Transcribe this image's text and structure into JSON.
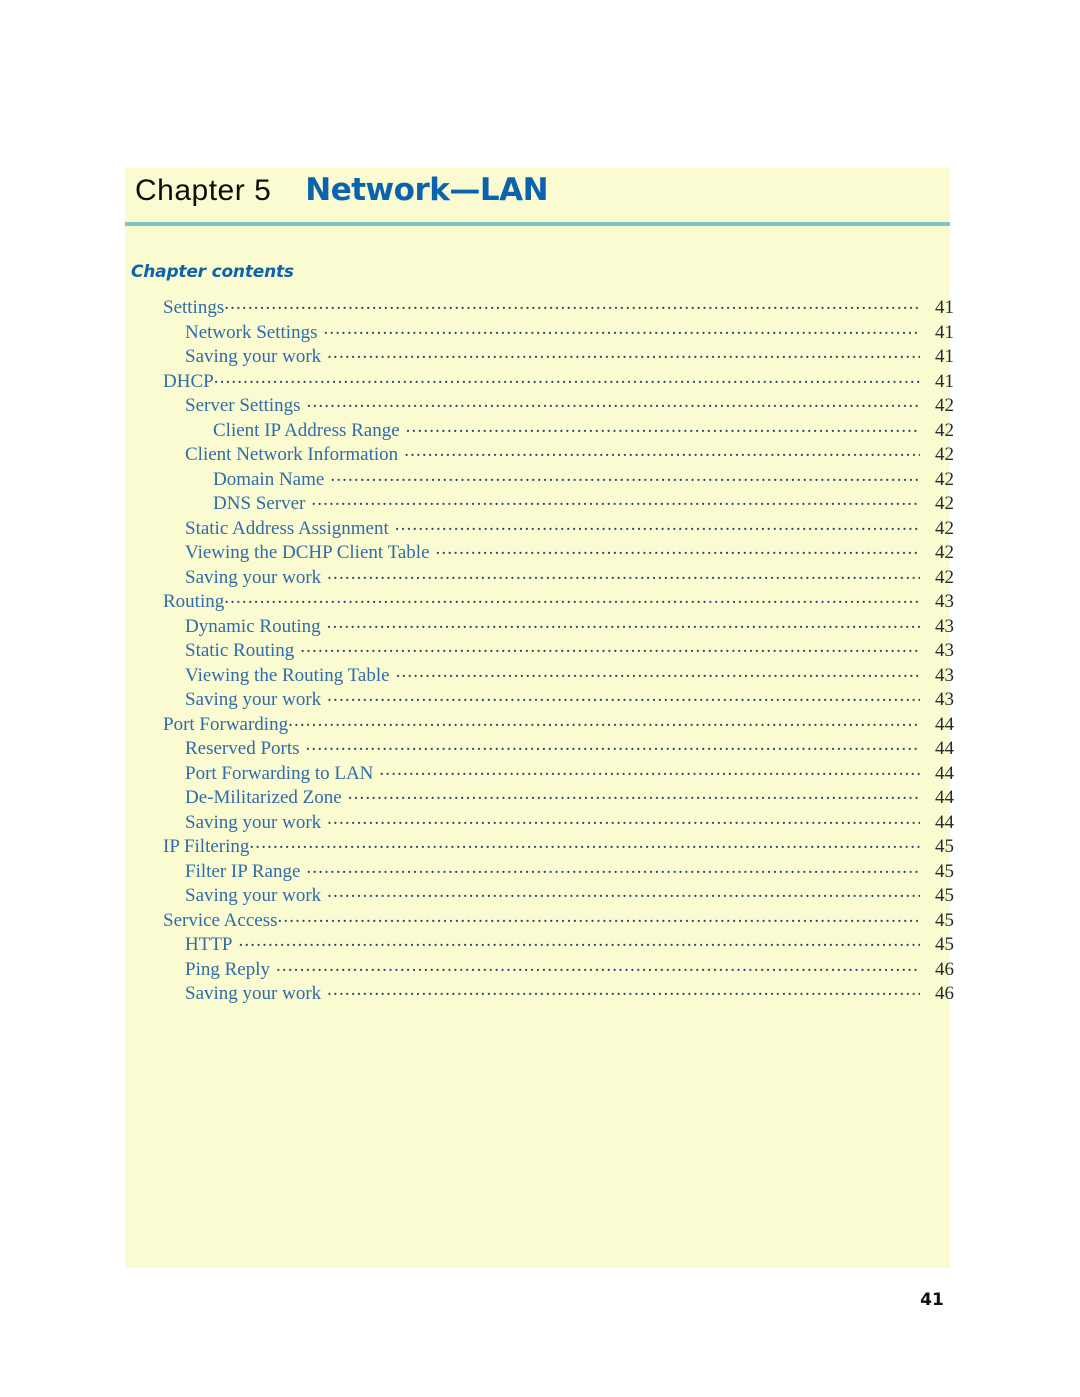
{
  "colors": {
    "page_tint": "#fbfbd2",
    "title_blue": "#0b63ad",
    "toc_blue": "#2f6ca8",
    "rule_teal": "#7ec6bf",
    "leader_dots": "#24486e",
    "folio_black": "#111111"
  },
  "header": {
    "chapter_word": "Chapter 5",
    "chapter_title": "Network—LAN"
  },
  "contents": {
    "heading": "Chapter contents",
    "entries": [
      {
        "level": 1,
        "label": "Settings",
        "page": "41"
      },
      {
        "level": 2,
        "label": "Network Settings",
        "page": "41"
      },
      {
        "level": 2,
        "label": "Saving your work",
        "page": "41"
      },
      {
        "level": 1,
        "label": "DHCP",
        "page": "41"
      },
      {
        "level": 2,
        "label": "Server Settings",
        "page": "42"
      },
      {
        "level": 3,
        "label": "Client IP Address Range",
        "page": "42"
      },
      {
        "level": 2,
        "label": "Client Network Information",
        "page": "42"
      },
      {
        "level": 3,
        "label": "Domain Name",
        "page": "42"
      },
      {
        "level": 3,
        "label": "DNS Server",
        "page": "42"
      },
      {
        "level": 2,
        "label": "Static Address Assignment",
        "page": "42"
      },
      {
        "level": 2,
        "label": "Viewing the DCHP Client Table",
        "page": "42"
      },
      {
        "level": 2,
        "label": "Saving your work",
        "page": "42"
      },
      {
        "level": 1,
        "label": "Routing",
        "page": "43"
      },
      {
        "level": 2,
        "label": "Dynamic Routing",
        "page": "43"
      },
      {
        "level": 2,
        "label": "Static Routing",
        "page": "43"
      },
      {
        "level": 2,
        "label": "Viewing the Routing Table",
        "page": "43"
      },
      {
        "level": 2,
        "label": "Saving your work",
        "page": "43"
      },
      {
        "level": 1,
        "label": "Port Forwarding",
        "page": "44"
      },
      {
        "level": 2,
        "label": "Reserved Ports",
        "page": "44"
      },
      {
        "level": 2,
        "label": "Port Forwarding to LAN",
        "page": "44"
      },
      {
        "level": 2,
        "label": "De-Militarized Zone",
        "page": "44"
      },
      {
        "level": 2,
        "label": "Saving your work",
        "page": "44"
      },
      {
        "level": 1,
        "label": "IP Filtering",
        "page": "45"
      },
      {
        "level": 2,
        "label": "Filter IP Range",
        "page": "45"
      },
      {
        "level": 2,
        "label": "Saving your work",
        "page": "45"
      },
      {
        "level": 1,
        "label": "Service Access",
        "page": "45"
      },
      {
        "level": 2,
        "label": "HTTP",
        "page": "45"
      },
      {
        "level": 2,
        "label": "Ping Reply",
        "page": "46"
      },
      {
        "level": 2,
        "label": "Saving your work",
        "page": "46"
      }
    ]
  },
  "footer": {
    "folio": "41"
  }
}
